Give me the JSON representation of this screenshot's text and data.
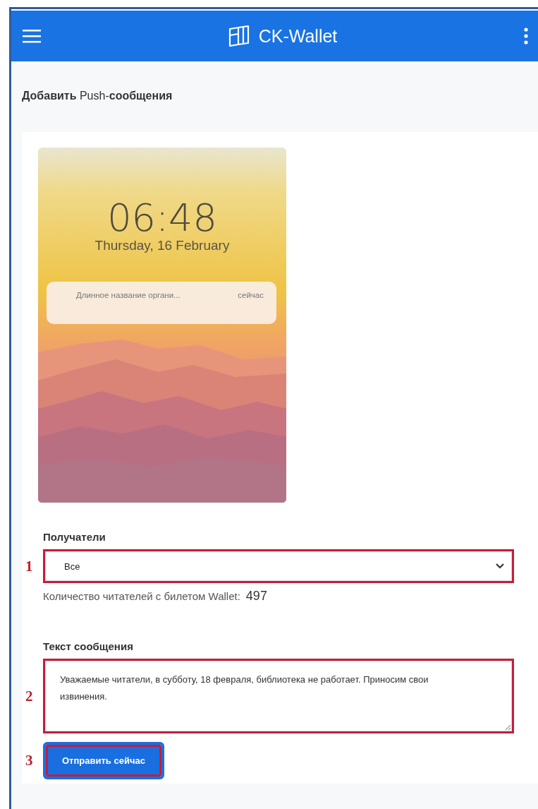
{
  "app_bar": {
    "title": "CK-Wallet"
  },
  "page_title": "**Добавить** Push-**сообщения**",
  "preview": {
    "time": "06:48",
    "date": "Thursday, 16 February",
    "notification": {
      "sender": "Длинное название органи...",
      "time": "сейчас"
    }
  },
  "recipients": {
    "label": "Получатели",
    "value": "Все",
    "marker": "1",
    "count_label": "Количество читателей с билетом Wallet:",
    "count": "497"
  },
  "message": {
    "label": "Текст сообщения",
    "value": "Уважаемые читатели, в субботу, 18 февраля, библиотека не работает. Приносим свои извинения.",
    "marker": "2"
  },
  "send_button": {
    "label": "Отправить сейчас",
    "marker": "3"
  }
}
